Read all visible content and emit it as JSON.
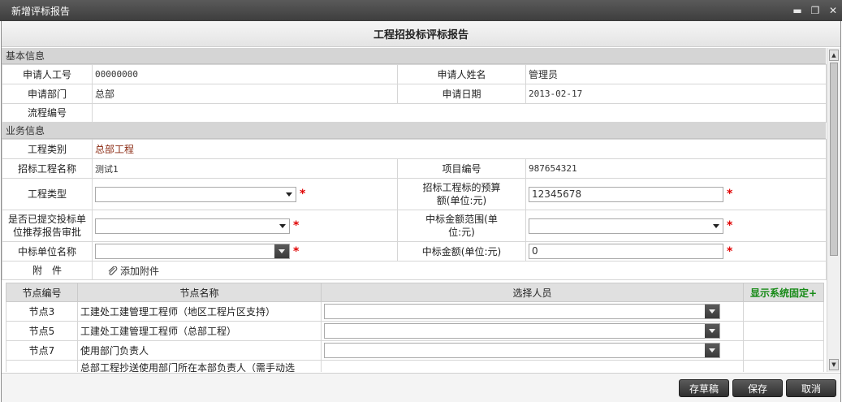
{
  "window": {
    "title": "新增评标报告",
    "minimize": "▬",
    "restore": "❐",
    "close": "✕"
  },
  "header": {
    "title": "工程招投标评标报告"
  },
  "basic": {
    "section_title": "基本信息",
    "applicant_id_label": "申请人工号",
    "applicant_id": "00000000",
    "applicant_name_label": "申请人姓名",
    "applicant_name": "管理员",
    "department_label": "申请部门",
    "department": "总部",
    "date_label": "申请日期",
    "date": "2013-02-17",
    "process_no_label": "流程编号",
    "process_no": ""
  },
  "business": {
    "section_title": "业务信息",
    "category_label": "工程类别",
    "category": "总部工程",
    "project_name_label": "招标工程名称",
    "project_name": "测试1",
    "project_no_label": "项目编号",
    "project_no": "987654321",
    "project_type_label": "工程类型",
    "project_type": "",
    "budget_label_1": "招标工程标的预算",
    "budget_label_2": "额(单位:元)",
    "budget": "12345678",
    "submitted_label_1": "是否已提交投标单",
    "submitted_label_2": "位推荐报告审批",
    "submitted": "",
    "amount_range_label_1": "中标金额范围(单",
    "amount_range_label_2": "位:元)",
    "amount_range": "",
    "winner_label": "中标单位名称",
    "winner": "",
    "win_amount_label": "中标金额(单位:元)",
    "win_amount": "0",
    "attachment_label": "附　件",
    "add_attachment": "添加附件"
  },
  "nodes": {
    "headers": [
      "节点编号",
      "节点名称",
      "选择人员"
    ],
    "show_fixed": "显示系统固定+",
    "rows": [
      {
        "id": "节点3",
        "name": "工建处工建管理工程师（地区工程片区支持）"
      },
      {
        "id": "节点5",
        "name": "工建处工建管理工程师（总部工程）"
      },
      {
        "id": "节点7",
        "name": "使用部门负责人"
      },
      {
        "id": "",
        "name": "总部工程抄送使用部门所在本部负责人（需手动选"
      }
    ]
  },
  "footer": {
    "draft": "存草稿",
    "save": "保存",
    "cancel": "取消"
  },
  "colors": {
    "required": "#e00000",
    "link": "#8b2a12",
    "show_fixed": "#178a17"
  }
}
